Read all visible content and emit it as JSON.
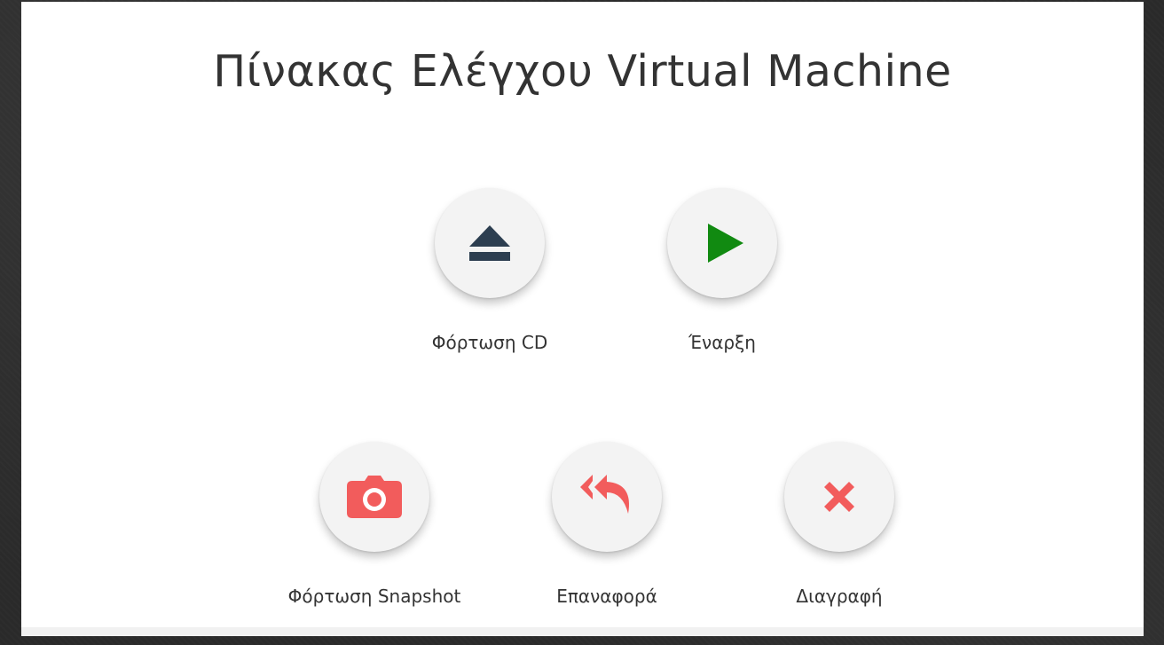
{
  "title": "Πίνακας Ελέγχου Virtual Machine",
  "colors": {
    "dark_icon": "#2c3e50",
    "play_icon": "#118a11",
    "accent_red": "#f25c5c",
    "button_bg": "#f3f3f3"
  },
  "actions": [
    {
      "label": "Φόρτωση CD",
      "icon": "eject-icon"
    },
    {
      "label": "Έναρξη",
      "icon": "play-icon"
    },
    {
      "label": "Φόρτωση Snapshot",
      "icon": "camera-icon"
    },
    {
      "label": "Επαναφορά",
      "icon": "reply-all-icon"
    },
    {
      "label": "Διαγραφή",
      "icon": "close-icon"
    }
  ]
}
